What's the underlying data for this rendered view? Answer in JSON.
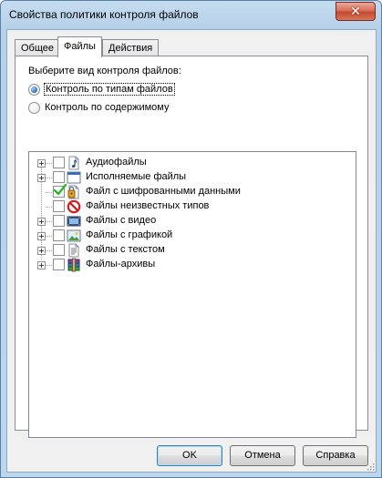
{
  "window": {
    "title": "Свойства политики контроля файлов",
    "close_label": "✕"
  },
  "tabs": [
    {
      "label": "Общее",
      "active": false
    },
    {
      "label": "Файлы",
      "active": true
    },
    {
      "label": "Действия",
      "active": false
    }
  ],
  "panel": {
    "prompt": "Выберите вид контроля файлов:",
    "options": [
      {
        "label": "Контроль по типам файлов",
        "checked": true
      },
      {
        "label": "Контроль по содержимому",
        "checked": false
      }
    ]
  },
  "tree": {
    "items": [
      {
        "label": "Аудиофайлы",
        "expandable": true,
        "checked": false,
        "icon": "audio-file-icon"
      },
      {
        "label": "Исполняемые файлы",
        "expandable": true,
        "checked": false,
        "icon": "executable-file-icon"
      },
      {
        "label": "Файл с шифрованными данными",
        "expandable": false,
        "checked": true,
        "icon": "encrypted-file-icon"
      },
      {
        "label": "Файлы неизвестных типов",
        "expandable": false,
        "checked": false,
        "icon": "unknown-type-icon"
      },
      {
        "label": "Файлы с видео",
        "expandable": true,
        "checked": false,
        "icon": "video-file-icon"
      },
      {
        "label": "Файлы с графикой",
        "expandable": true,
        "checked": false,
        "icon": "image-file-icon"
      },
      {
        "label": "Файлы с текстом",
        "expandable": true,
        "checked": false,
        "icon": "text-file-icon"
      },
      {
        "label": "Файлы-архивы",
        "expandable": true,
        "checked": false,
        "icon": "archive-file-icon"
      }
    ]
  },
  "buttons": {
    "ok": "OK",
    "cancel": "Отмена",
    "help": "Справка"
  },
  "colors": {
    "title_bar": "#bcd6ec",
    "close_button": "#c34a30",
    "check_mark": "#2bb52b",
    "forbidden": "#d21d1d"
  }
}
